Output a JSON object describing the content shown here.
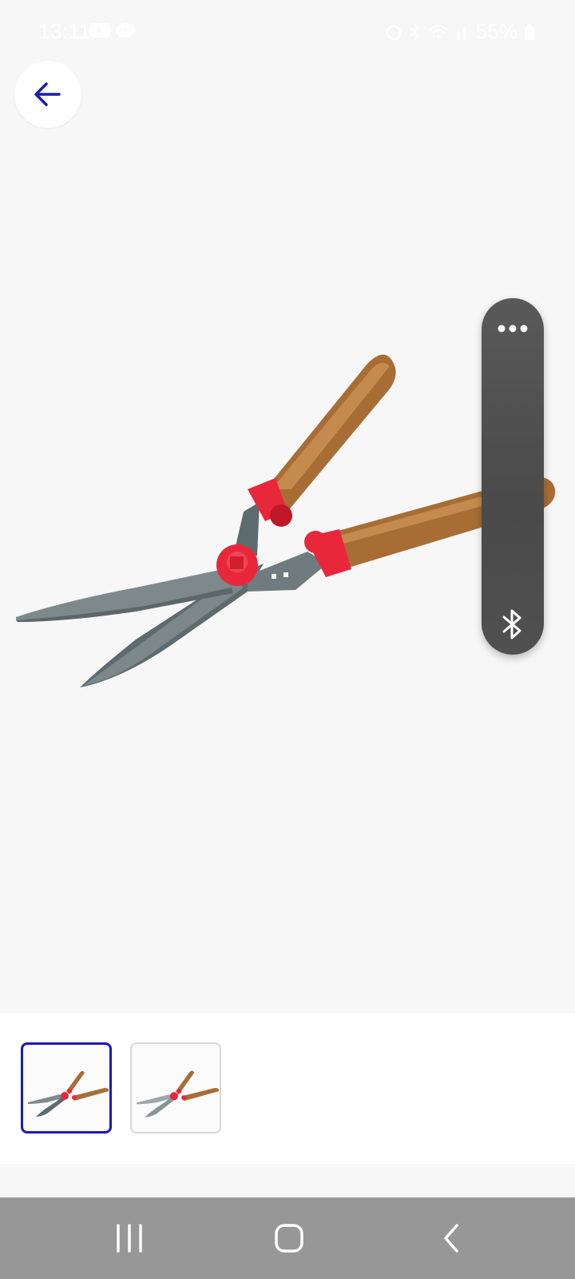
{
  "status_bar": {
    "time": "13:11",
    "battery_percent": "55%",
    "left_icons": [
      "youtube-icon",
      "chat-bubble-icon"
    ],
    "right_icons": [
      "alarm-icon",
      "bluetooth-icon",
      "wifi-icon",
      "signal-icon",
      "battery-icon"
    ]
  },
  "header": {
    "back_icon": "back-arrow-icon"
  },
  "product": {
    "image": "hedge-shears-image"
  },
  "floating_panel": {
    "top_icon": "more-dots-icon",
    "bottom_icon": "bluetooth-icon"
  },
  "gallery": {
    "thumbnails": [
      {
        "image": "hedge-shears-thumbnail",
        "selected": true
      },
      {
        "image": "hedge-shears-thumbnail",
        "selected": false
      }
    ]
  },
  "navigation_bar": {
    "buttons": [
      "recents-icon",
      "home-icon",
      "back-icon"
    ]
  },
  "colors": {
    "accent": "#1a1ab8",
    "background": "#f7f7f7",
    "panel": "#4e4e4e",
    "nav_bar": "#979797",
    "handle_wood": "#a86d35",
    "grip_red": "#e8283a",
    "blade_gray": "#6f7b7e"
  }
}
